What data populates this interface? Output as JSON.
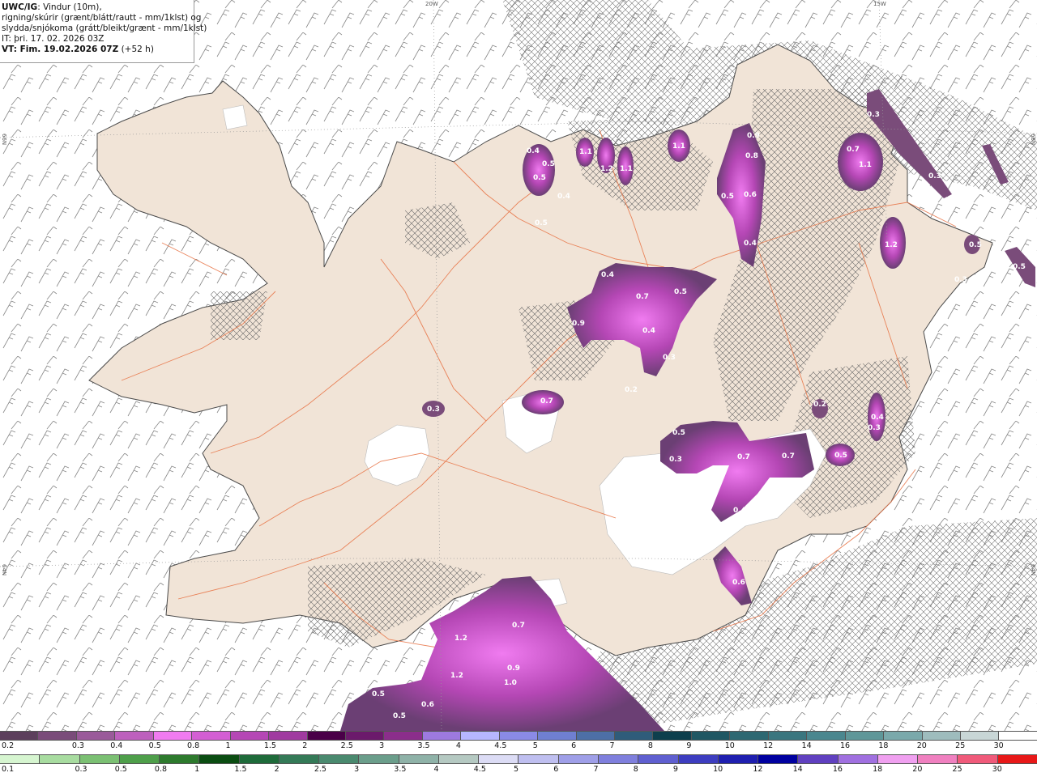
{
  "header": {
    "line1_bold": "UWC/IG",
    "line1_rest": ": Vindur (10m),",
    "line2": "rigning/skúrir (grænt/blátt/rautt - mm/1klst) og",
    "line3": "slydda/snjókoma (grátt/bleikt/grænt - mm/1klst)",
    "line4": "IT: þri. 17. 02. 2026 03Z",
    "line5_bold": "VT: Fim. 19.02.2026 07Z",
    "line5_rest": " (+52 h)"
  },
  "grid_labels": {
    "top_20w": "20W",
    "top_15w": "15W",
    "left_66n": "66N",
    "right_66n": "66N",
    "left_64n": "64N",
    "right_64n": "64N"
  },
  "precip_values": [
    "0.4",
    "0.5",
    "0.5",
    "0.4",
    "0.5",
    "1.1",
    "1.2",
    "1.1",
    "1.1",
    "0.9",
    "0.8",
    "0.6",
    "0.5",
    "0.4",
    "0.7",
    "1.1",
    "0.3",
    "0.3",
    "1.2",
    "0.5",
    "0.3",
    "0.5",
    "0.4",
    "0.7",
    "0.5",
    "0.9",
    "0.4",
    "0.3",
    "0.7",
    "0.3",
    "0.2",
    "0.2",
    "0.4",
    "0.3",
    "0.5",
    "0.7",
    "0.7",
    "0.3",
    "0.4",
    "0.5",
    "0.6",
    "0.7",
    "1.2",
    "0.9",
    "1.0",
    "1.2",
    "0.5",
    "0.6",
    "0.5"
  ],
  "snow_scale": {
    "colors": [
      "#5c3f5c",
      "#7a4c7a",
      "#9a5a9a",
      "#bd60bd",
      "#f07bf0",
      "#d35ed3",
      "#b547b5",
      "#a03aa0",
      "#4a0048",
      "#6b1a6b",
      "#8b2e8b",
      "#9d7adf",
      "#b6b6ff",
      "#8a8ae6",
      "#6f7fd1",
      "#4d6fa6",
      "#2f5c7a",
      "#0d3f4d",
      "#1f5763",
      "#2d6872",
      "#3a767f",
      "#4a878f",
      "#5f9799",
      "#7aa9ab",
      "#9ebcbd",
      "#c8d6d6",
      "#ffffff"
    ],
    "labels": [
      "0.2",
      "0.3",
      "0.4",
      "0.5",
      "0.8",
      "1",
      "1.5",
      "2",
      "2.5",
      "3",
      "3.5",
      "4",
      "4.5",
      "5",
      "6",
      "7",
      "8",
      "9",
      "10",
      "12",
      "14",
      "16",
      "18",
      "20",
      "25",
      "30"
    ]
  },
  "rain_scale": {
    "colors": [
      "#d6f5d0",
      "#a8dca0",
      "#7bc073",
      "#4e9f4a",
      "#2d7a2d",
      "#0b4d12",
      "#1e6b3a",
      "#347a57",
      "#4a8a6f",
      "#6b9e8b",
      "#8fb2a8",
      "#b5c9c2",
      "#dcdcf5",
      "#bfbff0",
      "#9f9fe8",
      "#7f7fdd",
      "#5f5fd0",
      "#3d3dc0",
      "#1f1fb0",
      "#0000a0",
      "#6040c0",
      "#a070e0",
      "#f0a0f0",
      "#f080c0",
      "#f05a7a",
      "#e81818"
    ],
    "labels": [
      "0.1",
      "0.3",
      "0.5",
      "0.8",
      "1",
      "1.5",
      "2",
      "2.5",
      "3",
      "3.5",
      "4",
      "4.5",
      "5",
      "6",
      "7",
      "8",
      "9",
      "10",
      "12",
      "14",
      "16",
      "18",
      "20",
      "25",
      "30"
    ]
  },
  "colors": {
    "land": "#f1e4d7",
    "coast": "#4a4a4a",
    "roads": "#e8774a",
    "snow_purple": "#b43cbc",
    "snow_dark": "#6b3f74"
  }
}
